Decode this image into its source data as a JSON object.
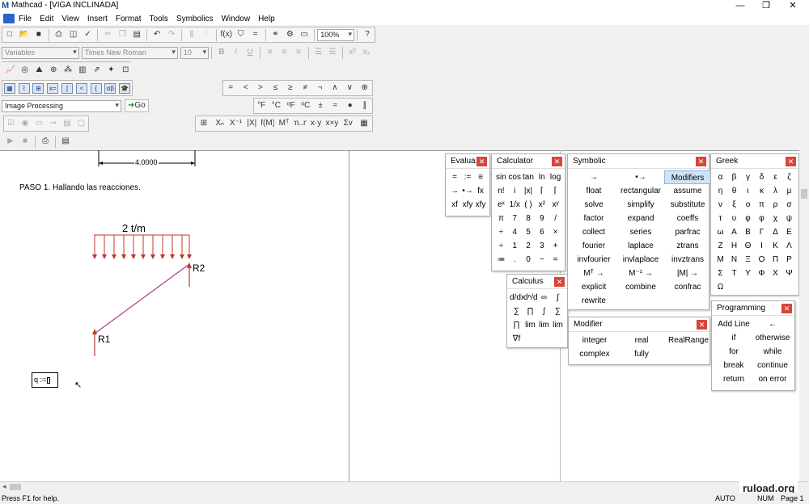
{
  "window": {
    "title": "Mathcad - [VIGA INCLINADA]",
    "logo": "M",
    "minimize": "—",
    "restore": "❐",
    "close": "✕"
  },
  "menu": [
    "File",
    "Edit",
    "View",
    "Insert",
    "Format",
    "Tools",
    "Symbolics",
    "Window",
    "Help"
  ],
  "toolbar": {
    "zoom": "100%",
    "style_dropdown": "Variables",
    "font_dropdown": "Times New Roman",
    "size_dropdown": "10",
    "component_dropdown": "Image Processing",
    "go_label": "Go",
    "bold": "B",
    "italic": "I",
    "underline": "U"
  },
  "boolean_toolbar": [
    "=",
    "<",
    ">",
    "≤",
    "≥",
    "≠",
    "¬",
    "∧",
    "∨",
    "⊕"
  ],
  "units_toolbar": [
    "°F",
    "°C",
    "ᵒF",
    "ᵒC",
    "±",
    "≈",
    "●",
    "∥"
  ],
  "matrix_toolbar": [
    "⊞",
    "Xₙ",
    "X⁻¹",
    "|X|",
    "f(M)",
    "Mᵀ",
    "m..n",
    "x·y",
    "x×y",
    "Σv",
    "▦"
  ],
  "worksheet": {
    "dimension": "4.0000",
    "step_text": "PASO 1. Hallando las reacciones.",
    "load": "2  t/m",
    "r1": "R1",
    "r2": "R2",
    "expression": "q :=",
    "colors": {
      "beam": "#b23a8a",
      "load": "#c0392b"
    }
  },
  "panels": {
    "evaluation": {
      "title": "Evalua...",
      "items": [
        "=",
        ":=",
        "≡",
        "→",
        "•→",
        "fx",
        "xf",
        "xfy",
        "xfy"
      ]
    },
    "calculator": {
      "title": "Calculator",
      "items": [
        "sin",
        "cos",
        "tan",
        "ln",
        "log",
        "n!",
        "i",
        "|x|",
        "⌈",
        "⌈",
        "eˣ",
        "1/x",
        "( )",
        "x²",
        "xʸ",
        "π",
        "7",
        "8",
        "9",
        "/",
        "÷",
        "4",
        "5",
        "6",
        "×",
        "÷",
        "1",
        "2",
        "3",
        "+",
        "≔",
        ".",
        "0",
        "−",
        "="
      ]
    },
    "calculus": {
      "title": "Calculus",
      "items": [
        "d/dx",
        "dⁿ/dxⁿ",
        "∞",
        "∫",
        "∑",
        "∏",
        "∫",
        "∑",
        "∏",
        "lim",
        "lim",
        "lim",
        "∇f"
      ]
    },
    "symbolic": {
      "title": "Symbolic",
      "items": [
        "→",
        "•→",
        "Modifiers",
        "float",
        "rectangular",
        "assume",
        "solve",
        "simplify",
        "substitute",
        "factor",
        "expand",
        "coeffs",
        "collect",
        "series",
        "parfrac",
        "fourier",
        "laplace",
        "ztrans",
        "invfourier",
        "invlaplace",
        "invztrans",
        "Mᵀ →",
        "M⁻¹ →",
        "|M| →",
        "explicit",
        "combine",
        "confrac",
        "rewrite",
        "",
        ""
      ]
    },
    "modifier": {
      "title": "Modifier",
      "items": [
        "integer",
        "real",
        "RealRange",
        "complex",
        "fully",
        ""
      ]
    },
    "greek": {
      "title": "Greek",
      "items": [
        "α",
        "β",
        "γ",
        "δ",
        "ε",
        "ζ",
        "η",
        "θ",
        "ι",
        "κ",
        "λ",
        "μ",
        "ν",
        "ξ",
        "ο",
        "π",
        "ρ",
        "σ",
        "τ",
        "υ",
        "φ",
        "φ",
        "χ",
        "ψ",
        "ω",
        "Α",
        "Β",
        "Γ",
        "Δ",
        "Ε",
        "Ζ",
        "Η",
        "Θ",
        "Ι",
        "Κ",
        "Λ",
        "Μ",
        "Ν",
        "Ξ",
        "Ο",
        "Π",
        "Ρ",
        "Σ",
        "Τ",
        "Υ",
        "Φ",
        "Χ",
        "Ψ",
        "Ω"
      ]
    },
    "programming": {
      "title": "Programming",
      "items": [
        "Add Line",
        "←",
        "if",
        "otherwise",
        "for",
        "while",
        "break",
        "continue",
        "return",
        "on error"
      ]
    }
  },
  "status": {
    "help": "Press F1 for help.",
    "mode": "AUTO",
    "num": "NUM",
    "page": "Page 1"
  },
  "watermark": "ruload.org"
}
